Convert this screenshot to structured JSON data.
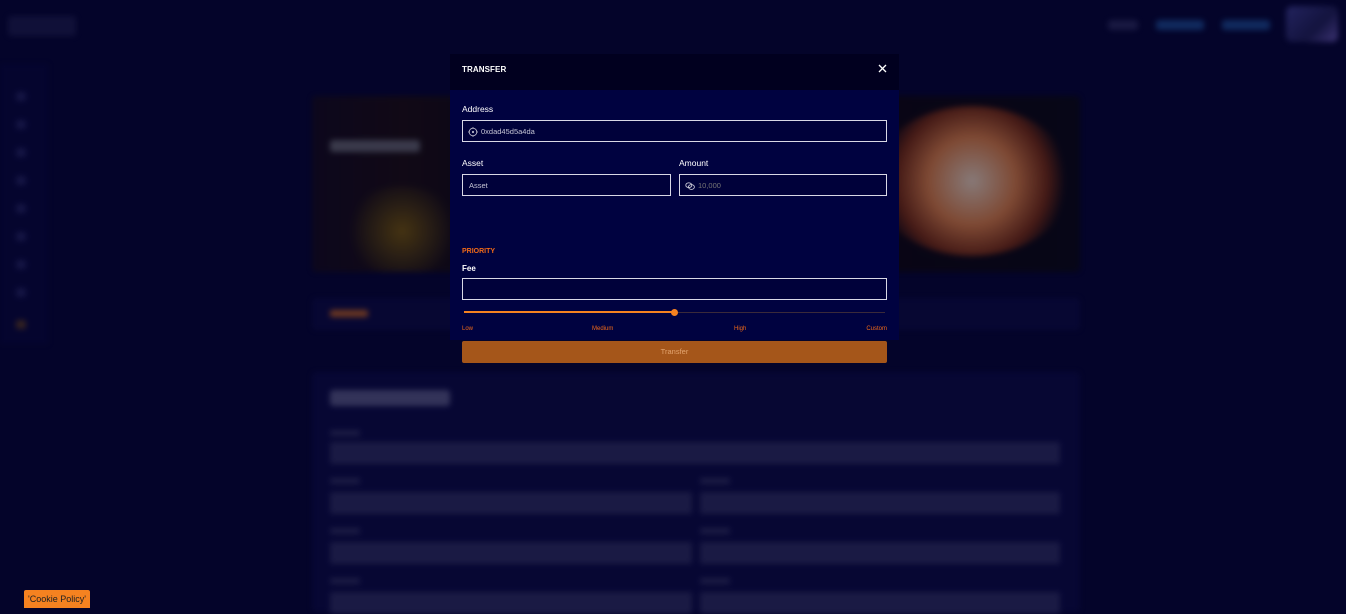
{
  "modal": {
    "title": "TRANSFER",
    "close_icon": "close-icon",
    "address": {
      "label": "Address",
      "value": "0xdad45d5a4da",
      "icon": "target-icon"
    },
    "asset": {
      "label": "Asset",
      "value": "Asset"
    },
    "amount": {
      "label": "Amount",
      "placeholder": "10,000",
      "icon": "coins-icon"
    },
    "priority_label": "PRIORITY",
    "fee": {
      "label": "Fee",
      "value": ""
    },
    "slider": {
      "level": 0.5,
      "ticks": [
        "Low",
        "Medium",
        "High",
        "Custom"
      ]
    },
    "submit_label": "Transfer"
  },
  "cookie_badge": "'Cookie Policy'",
  "colors": {
    "accent": "#f58220",
    "modal_bg": "#000240",
    "page_bg": "#04042a",
    "button_bg": "#a5561a"
  }
}
